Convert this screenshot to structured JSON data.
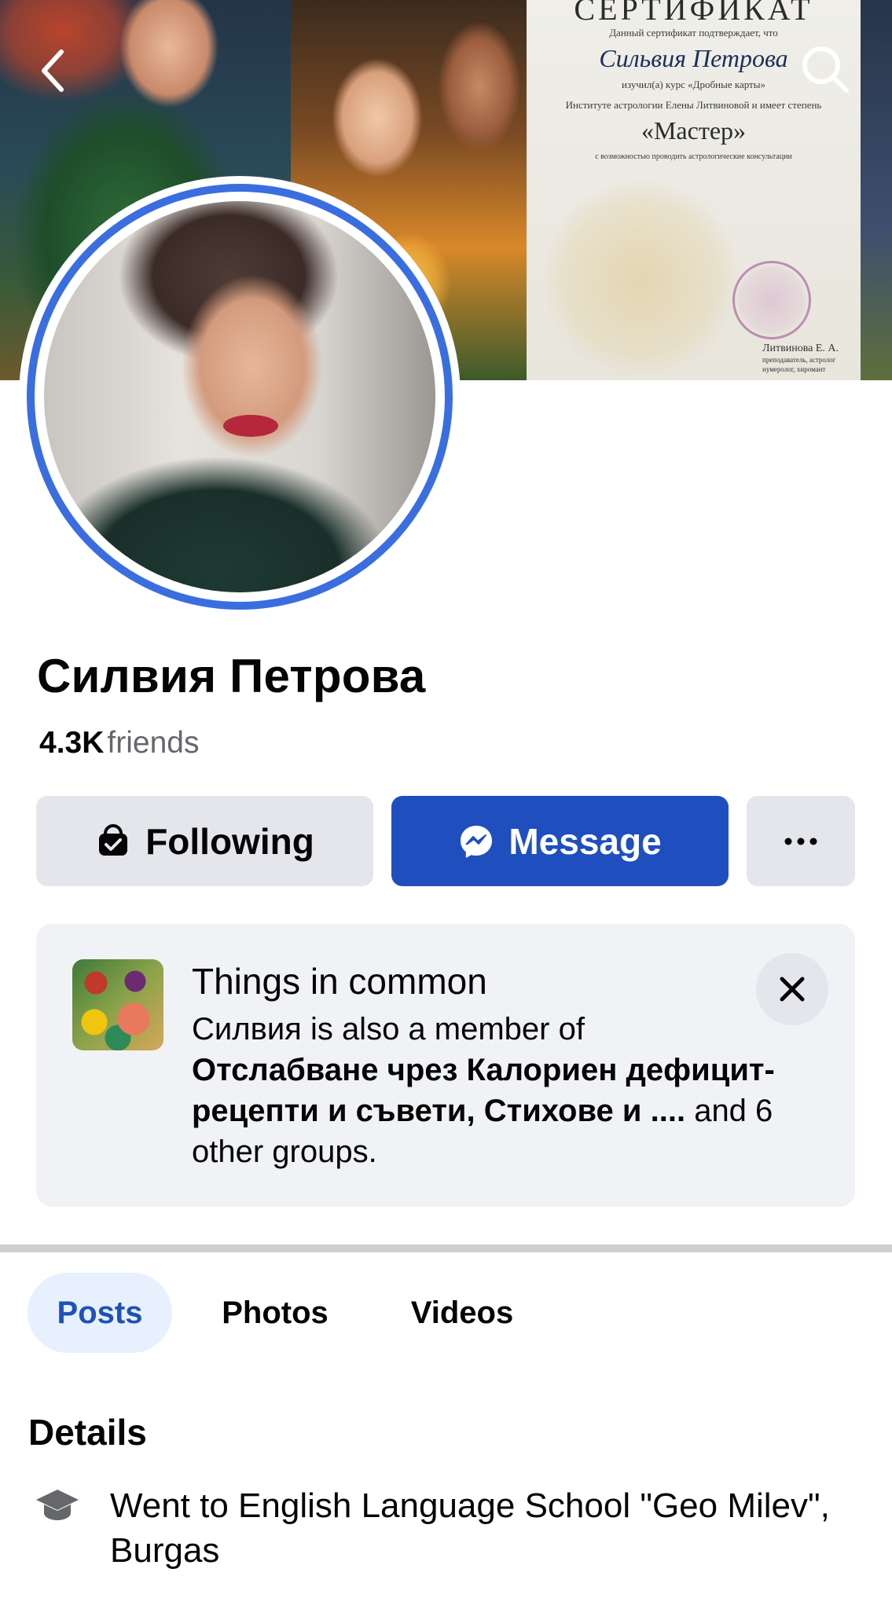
{
  "cover": {
    "certificate": {
      "title": "СЕРТИФИКАТ",
      "line1": "Данный сертификат подтверждает, что",
      "name": "Сильвия Петрова",
      "line2": "изучил(а) курс «Дробные карты»",
      "line3": "Институте астрологии Елены Литвиновой и имеет степень",
      "degree": "«Мастер»",
      "line4": "с возможностью проводить астрологические консультации",
      "signer": "Литвинова Е. А.",
      "signer_role1": "преподаватель, астролог",
      "signer_role2": "нумеролог, хиромант"
    }
  },
  "icons": {
    "back": "chevron-left-icon",
    "search": "search-icon",
    "following": "following-bag-icon",
    "message": "messenger-icon",
    "more": "more-dots-icon",
    "close": "close-icon",
    "school": "graduation-cap-icon"
  },
  "colors": {
    "accent": "#1f4fbf",
    "avatar_ring": "#3a6ee0",
    "tab_active_bg": "#e7f0fd",
    "tab_active_text": "#1e52b7"
  },
  "profile": {
    "name": "Силвия Петрова",
    "friends_count": "4.3K",
    "friends_label": "friends"
  },
  "actions": {
    "following_label": "Following",
    "message_label": "Message",
    "more_label": "···"
  },
  "common": {
    "title": "Things in common",
    "intro": "Силвия is also a member of",
    "groups_bold": "Отслабване чрез Калориен дефицит- рецепти и съвети, Стихове и ....",
    "rest": " and 6 other groups."
  },
  "tabs": [
    {
      "label": "Posts",
      "active": true
    },
    {
      "label": "Photos",
      "active": false
    },
    {
      "label": "Videos",
      "active": false
    }
  ],
  "details": {
    "title": "Details",
    "items": [
      {
        "icon": "graduation-cap-icon",
        "text": "Went to English Language School \"Geo Milev\", Burgas"
      }
    ]
  }
}
